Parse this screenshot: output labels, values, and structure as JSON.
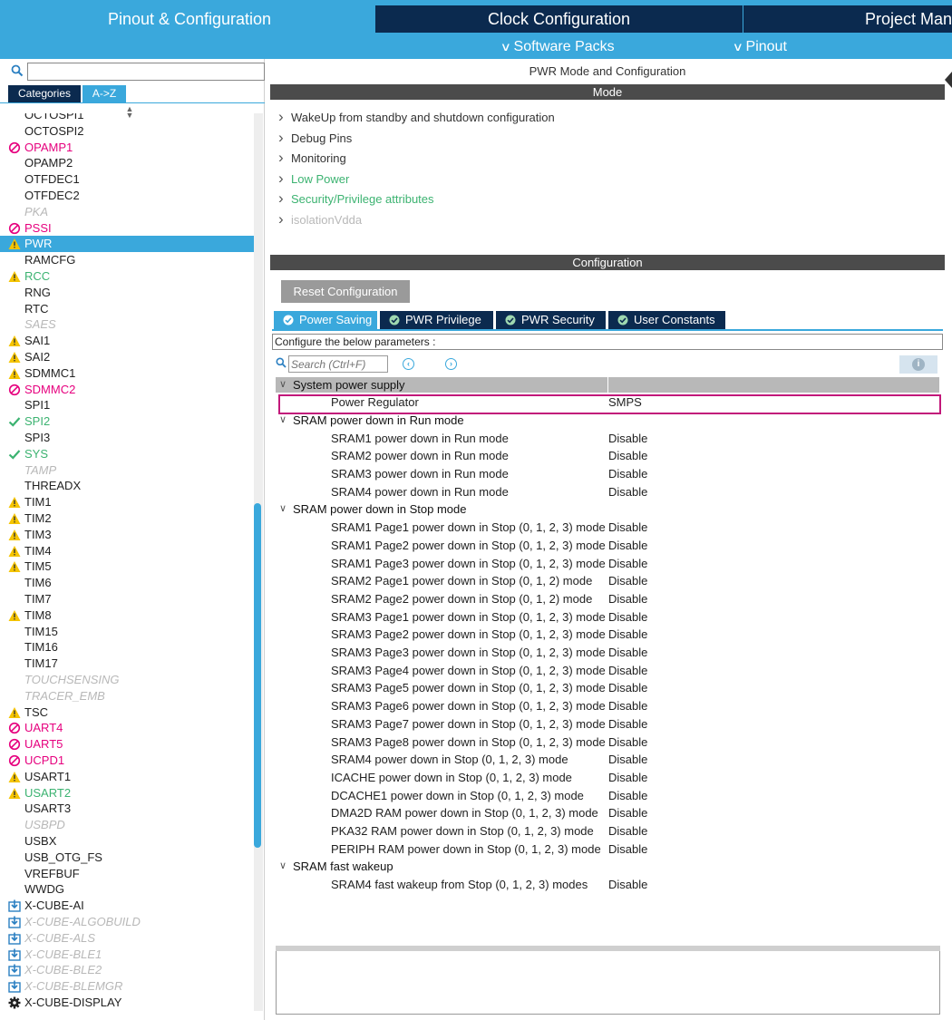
{
  "top_tabs": {
    "pinout": "Pinout & Configuration",
    "clock": "Clock Configuration",
    "project": "Project Manager"
  },
  "sub_menu": {
    "software_packs": "Software Packs",
    "pinout": "Pinout"
  },
  "left": {
    "search_value": "",
    "tab_categories": "Categories",
    "tab_az": "A->Z",
    "items": [
      {
        "label": "OCTOSPI1",
        "status": "normal"
      },
      {
        "label": "OCTOSPI2",
        "status": "normal"
      },
      {
        "label": "OPAMP1",
        "status": "error"
      },
      {
        "label": "OPAMP2",
        "status": "normal"
      },
      {
        "label": "OTFDEC1",
        "status": "normal"
      },
      {
        "label": "OTFDEC2",
        "status": "normal"
      },
      {
        "label": "PKA",
        "status": "disabled"
      },
      {
        "label": "PSSI",
        "status": "error"
      },
      {
        "label": "PWR",
        "status": "selected"
      },
      {
        "label": "RAMCFG",
        "status": "normal"
      },
      {
        "label": "RCC",
        "status": "okwarn"
      },
      {
        "label": "RNG",
        "status": "normal"
      },
      {
        "label": "RTC",
        "status": "normal"
      },
      {
        "label": "SAES",
        "status": "disabled"
      },
      {
        "label": "SAI1",
        "status": "warn"
      },
      {
        "label": "SAI2",
        "status": "warn"
      },
      {
        "label": "SDMMC1",
        "status": "warn"
      },
      {
        "label": "SDMMC2",
        "status": "error"
      },
      {
        "label": "SPI1",
        "status": "normal"
      },
      {
        "label": "SPI2",
        "status": "ok"
      },
      {
        "label": "SPI3",
        "status": "normal"
      },
      {
        "label": "SYS",
        "status": "ok"
      },
      {
        "label": "TAMP",
        "status": "disabled"
      },
      {
        "label": "THREADX",
        "status": "normal"
      },
      {
        "label": "TIM1",
        "status": "warn"
      },
      {
        "label": "TIM2",
        "status": "warn"
      },
      {
        "label": "TIM3",
        "status": "warn"
      },
      {
        "label": "TIM4",
        "status": "warn"
      },
      {
        "label": "TIM5",
        "status": "warn"
      },
      {
        "label": "TIM6",
        "status": "normal"
      },
      {
        "label": "TIM7",
        "status": "normal"
      },
      {
        "label": "TIM8",
        "status": "warn"
      },
      {
        "label": "TIM15",
        "status": "normal"
      },
      {
        "label": "TIM16",
        "status": "normal"
      },
      {
        "label": "TIM17",
        "status": "normal"
      },
      {
        "label": "TOUCHSENSING",
        "status": "disabled"
      },
      {
        "label": "TRACER_EMB",
        "status": "disabled"
      },
      {
        "label": "TSC",
        "status": "warn"
      },
      {
        "label": "UART4",
        "status": "error"
      },
      {
        "label": "UART5",
        "status": "error"
      },
      {
        "label": "UCPD1",
        "status": "error"
      },
      {
        "label": "USART1",
        "status": "warn"
      },
      {
        "label": "USART2",
        "status": "okwarn"
      },
      {
        "label": "USART3",
        "status": "normal"
      },
      {
        "label": "USBPD",
        "status": "disabled"
      },
      {
        "label": "USBX",
        "status": "normal"
      },
      {
        "label": "USB_OTG_FS",
        "status": "normal"
      },
      {
        "label": "VREFBUF",
        "status": "normal"
      },
      {
        "label": "WWDG",
        "status": "normal"
      },
      {
        "label": "X-CUBE-AI",
        "status": "pack"
      },
      {
        "label": "X-CUBE-ALGOBUILD",
        "status": "packdis"
      },
      {
        "label": "X-CUBE-ALS",
        "status": "packdis"
      },
      {
        "label": "X-CUBE-BLE1",
        "status": "packdis"
      },
      {
        "label": "X-CUBE-BLE2",
        "status": "packdis"
      },
      {
        "label": "X-CUBE-BLEMGR",
        "status": "packdis"
      },
      {
        "label": "X-CUBE-DISPLAY",
        "status": "gear"
      }
    ]
  },
  "right": {
    "title": "PWR Mode and Configuration",
    "mode_header": "Mode",
    "mode_items": [
      {
        "label": "WakeUp from standby and shutdown configuration",
        "style": "normal"
      },
      {
        "label": "Debug Pins",
        "style": "normal"
      },
      {
        "label": "Monitoring",
        "style": "normal"
      },
      {
        "label": "Low Power",
        "style": "green"
      },
      {
        "label": "Security/Privilege attributes",
        "style": "green"
      },
      {
        "label": "isolationVdda",
        "style": "disabled"
      }
    ],
    "config_header": "Configuration",
    "reset_button": "Reset Configuration",
    "tabs": [
      "Power Saving",
      "PWR Privilege",
      "PWR Security",
      "User Constants"
    ],
    "hint": "Configure the below parameters :",
    "search_placeholder": "Search (Ctrl+F)",
    "groups": [
      {
        "name": "System power supply",
        "params": [
          {
            "name": "Power Regulator",
            "value": "SMPS"
          }
        ]
      },
      {
        "name": "SRAM power down in Run mode",
        "params": [
          {
            "name": "SRAM1 power down in Run mode",
            "value": "Disable"
          },
          {
            "name": "SRAM2 power down in Run mode",
            "value": "Disable"
          },
          {
            "name": "SRAM3 power down in Run mode",
            "value": "Disable"
          },
          {
            "name": "SRAM4 power down in Run mode",
            "value": "Disable"
          }
        ]
      },
      {
        "name": "SRAM power down in Stop mode",
        "params": [
          {
            "name": "SRAM1 Page1 power down in Stop (0, 1, 2, 3)  mode",
            "value": "Disable"
          },
          {
            "name": "SRAM1 Page2 power down in Stop (0, 1, 2, 3)  mode",
            "value": "Disable"
          },
          {
            "name": "SRAM1 Page3 power down in Stop (0, 1, 2, 3)  mode",
            "value": "Disable"
          },
          {
            "name": "SRAM2 Page1 power down in Stop (0, 1, 2)  mode",
            "value": "Disable"
          },
          {
            "name": "SRAM2 Page2 power down in Stop (0, 1, 2)  mode",
            "value": "Disable"
          },
          {
            "name": "SRAM3 Page1 power down in Stop (0, 1, 2, 3)  mode",
            "value": "Disable"
          },
          {
            "name": "SRAM3 Page2 power down in Stop (0, 1, 2, 3)  mode",
            "value": "Disable"
          },
          {
            "name": "SRAM3 Page3 power down in Stop (0, 1, 2, 3)  mode",
            "value": "Disable"
          },
          {
            "name": "SRAM3 Page4 power down in Stop (0, 1, 2, 3)  mode",
            "value": "Disable"
          },
          {
            "name": "SRAM3 Page5 power down in Stop (0, 1, 2, 3)  mode",
            "value": "Disable"
          },
          {
            "name": "SRAM3 Page6 power down in Stop (0, 1, 2, 3)  mode",
            "value": "Disable"
          },
          {
            "name": "SRAM3 Page7 power down in Stop (0, 1, 2, 3)  mode",
            "value": "Disable"
          },
          {
            "name": "SRAM3 Page8 power down in Stop (0, 1, 2, 3)  mode",
            "value": "Disable"
          },
          {
            "name": "SRAM4 power down in Stop (0, 1, 2, 3)  mode",
            "value": "Disable"
          },
          {
            "name": "ICACHE power down in Stop (0, 1, 2, 3)  mode",
            "value": "Disable"
          },
          {
            "name": "DCACHE1 power down in Stop (0, 1, 2, 3)  mode",
            "value": "Disable"
          },
          {
            "name": "DMA2D RAM power down in Stop (0, 1, 2, 3)  mode",
            "value": "Disable"
          },
          {
            "name": "PKA32 RAM power down in Stop (0, 1, 2, 3)  mode",
            "value": "Disable"
          },
          {
            "name": "PERIPH RAM power down in Stop (0, 1, 2, 3)  mode",
            "value": "Disable"
          }
        ]
      },
      {
        "name": "SRAM fast wakeup",
        "params": [
          {
            "name": "SRAM4 fast wakeup from Stop (0, 1, 2, 3) modes",
            "value": "Disable"
          }
        ]
      }
    ]
  },
  "colors": {
    "accent": "#3aa8dc",
    "dark_tab": "#0b2a4f",
    "error": "#e6007e",
    "ok": "#3cb371",
    "warn": "#f5c400",
    "highlight": "#c2187a"
  }
}
